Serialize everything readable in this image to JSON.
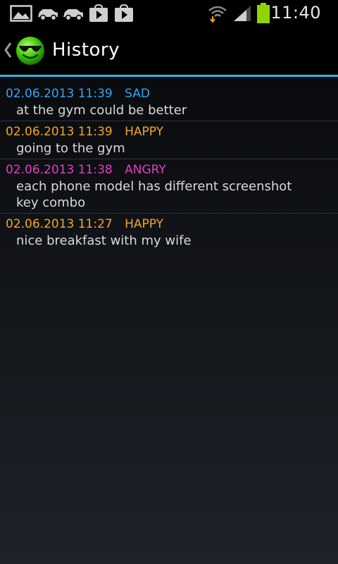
{
  "status_bar": {
    "time": "11:40",
    "icons": [
      "gallery-icon",
      "car-icon",
      "car-icon",
      "play-store-icon",
      "play-store-icon",
      "wifi-icon",
      "signal-icon",
      "battery-icon"
    ],
    "battery_color": "#8fd400"
  },
  "action_bar": {
    "title": "History",
    "app_icon": "smiley-sunglasses-icon",
    "back_icon": "chevron-left-icon",
    "accent_color": "#33b5e5"
  },
  "entries": [
    {
      "date": "02.06.2013 11:39",
      "mood": "SAD",
      "note": "at the gym  could be better",
      "color": "#3aa4ee"
    },
    {
      "date": "02.06.2013 11:39",
      "mood": "HAPPY",
      "note": "going to the gym",
      "color": "#f5a623"
    },
    {
      "date": "02.06.2013 11:38",
      "mood": "ANGRY",
      "note": "each phone model has different screenshot key combo",
      "color": "#e040c0"
    },
    {
      "date": "02.06.2013 11:27",
      "mood": "HAPPY",
      "note": "nice breakfast with my wife",
      "color": "#f5a623"
    }
  ]
}
